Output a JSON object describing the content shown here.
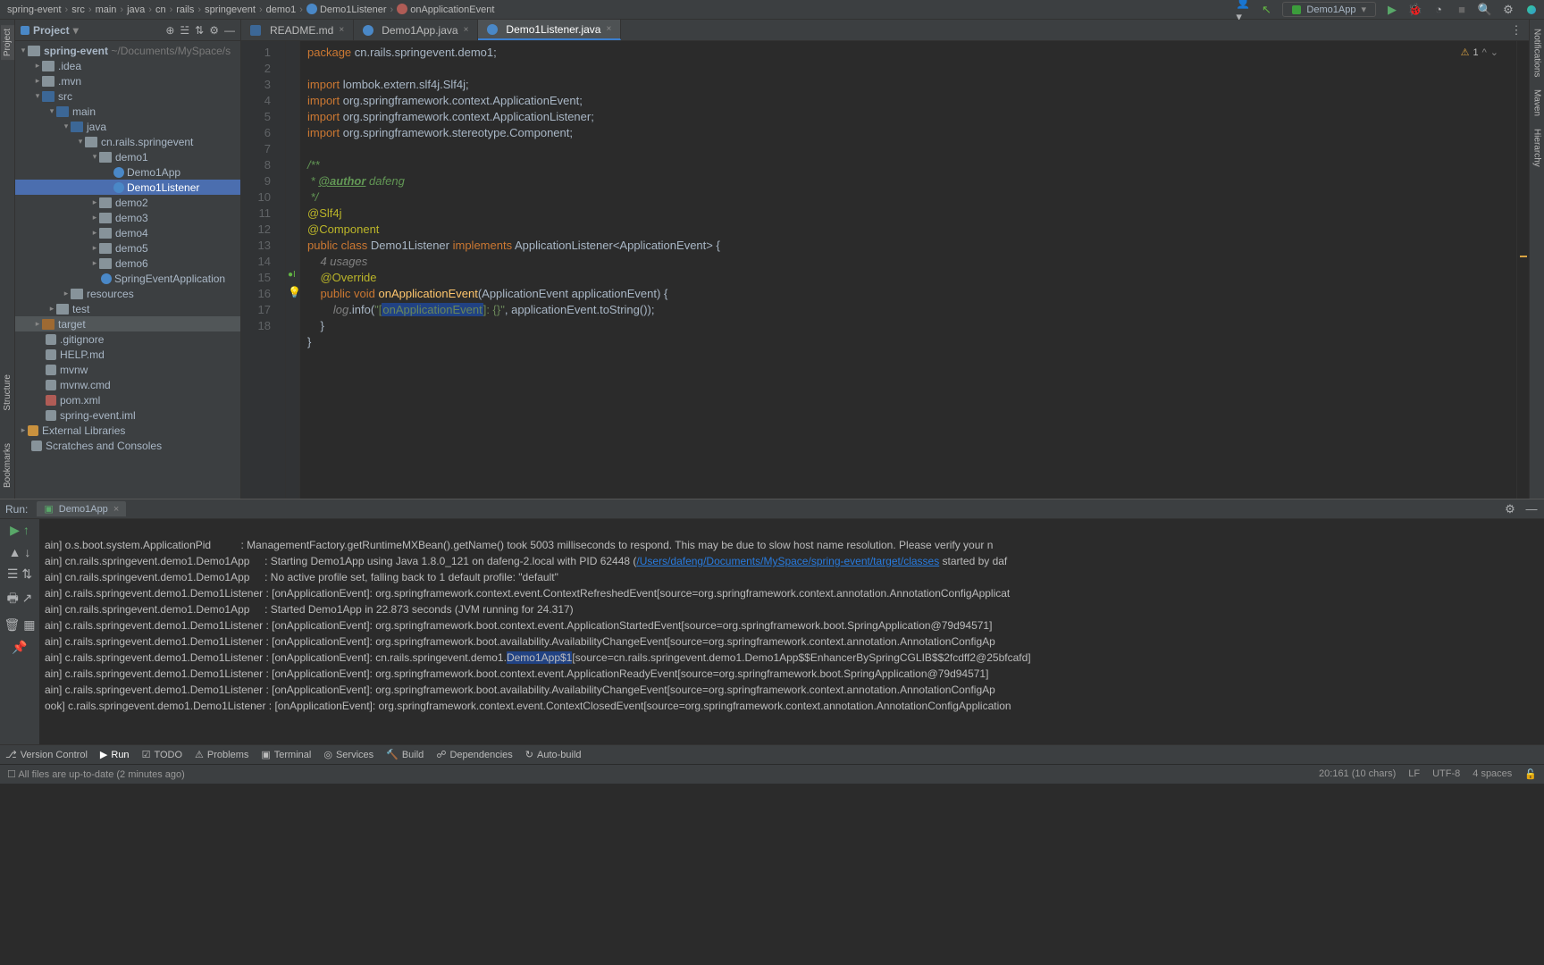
{
  "navbar": {
    "crumbs": [
      "spring-event",
      "src",
      "main",
      "java",
      "cn",
      "rails",
      "springevent",
      "demo1",
      "Demo1Listener",
      "onApplicationEvent"
    ],
    "runConfig": "Demo1App"
  },
  "leftStrip": {
    "project": "Project",
    "structure": "Structure",
    "bookmarks": "Bookmarks"
  },
  "rightStrip": {
    "notifications": "Notifications",
    "maven": "Maven",
    "hierarchy": "Hierarchy"
  },
  "sidebar": {
    "title": "Project",
    "root": {
      "name": "spring-event",
      "path": "~/Documents/MySpace/s"
    },
    "nodes": {
      "idea": ".idea",
      "mvn": ".mvn",
      "src": "src",
      "main": "main",
      "java": "java",
      "pkg": "cn.rails.springevent",
      "demo1": "demo1",
      "demo1app": "Demo1App",
      "demo1listener": "Demo1Listener",
      "demo2": "demo2",
      "demo3": "demo3",
      "demo4": "demo4",
      "demo5": "demo5",
      "demo6": "demo6",
      "springEventApp": "SpringEventApplication",
      "resources": "resources",
      "test": "test",
      "target": "target",
      "gitignore": ".gitignore",
      "help": "HELP.md",
      "mvnw": "mvnw",
      "mvnwcmd": "mvnw.cmd",
      "pom": "pom.xml",
      "iml": "spring-event.iml",
      "ext": "External Libraries",
      "scratch": "Scratches and Consoles"
    }
  },
  "tabs": {
    "t1": "README.md",
    "t2": "Demo1App.java",
    "t3": "Demo1Listener.java"
  },
  "editor": {
    "warnCount": "1",
    "usages": "4 usages",
    "pkg": "cn.rails.springevent.demo1",
    "imports": {
      "i1a": "lombok.extern.slf4j.",
      "i1b": "Slf4j",
      "i2": "org.springframework.context.ApplicationEvent",
      "i3": "org.springframework.context.ApplicationListener",
      "i4a": "org.springframework.stereotype.",
      "i4b": "Component"
    },
    "author_tag": "@author",
    "author": "dafeng",
    "ann1": "@Slf4j",
    "ann2": "@Component",
    "classname": "Demo1Listener",
    "impl": "ApplicationListener<ApplicationEvent>",
    "override": "@Override",
    "method": "onApplicationEvent",
    "param": "(ApplicationEvent applicationEvent)",
    "logvar": "log",
    "logcall": ".info(",
    "str1": "\"[",
    "selstr": "onApplicationEvent",
    "str2": "]: {}\"",
    "rest": ", applicationEvent.toString());"
  },
  "run": {
    "label": "Run:",
    "tab": "Demo1App",
    "lines": {
      "l1": "ain] o.s.boot.system.ApplicationPid          : ManagementFactory.getRuntimeMXBean().getName() took 5003 milliseconds to respond. This may be due to slow host name resolution. Please verify your n",
      "l2a": "ain] cn.rails.springevent.demo1.Demo1App     : Starting Demo1App using Java 1.8.0_121 on dafeng-2.local with PID 62448 (",
      "l2link": "/Users/dafeng/Documents/MySpace/spring-event/target/classes",
      "l2b": " started by daf",
      "l3": "ain] cn.rails.springevent.demo1.Demo1App     : No active profile set, falling back to 1 default profile: \"default\"",
      "l4": "ain] c.rails.springevent.demo1.Demo1Listener : [onApplicationEvent]: org.springframework.context.event.ContextRefreshedEvent[source=org.springframework.context.annotation.AnnotationConfigApplicat",
      "l5": "ain] cn.rails.springevent.demo1.Demo1App     : Started Demo1App in 22.873 seconds (JVM running for 24.317)",
      "l6": "ain] c.rails.springevent.demo1.Demo1Listener : [onApplicationEvent]: org.springframework.boot.context.event.ApplicationStartedEvent[source=org.springframework.boot.SpringApplication@79d94571]",
      "l7": "ain] c.rails.springevent.demo1.Demo1Listener : [onApplicationEvent]: org.springframework.boot.availability.AvailabilityChangeEvent[source=org.springframework.context.annotation.AnnotationConfigAp",
      "l8a": "ain] c.rails.springevent.demo1.Demo1Listener : [onApplicationEvent]: cn.rails.springevent.demo1.",
      "l8sel": "Demo1App$1",
      "l8b": "[source=cn.rails.springevent.demo1.Demo1App$$EnhancerBySpringCGLIB$$2fcdff2@25bfcafd]",
      "l9": "ain] c.rails.springevent.demo1.Demo1Listener : [onApplicationEvent]: org.springframework.boot.context.event.ApplicationReadyEvent[source=org.springframework.boot.SpringApplication@79d94571]",
      "l10": "ain] c.rails.springevent.demo1.Demo1Listener : [onApplicationEvent]: org.springframework.boot.availability.AvailabilityChangeEvent[source=org.springframework.context.annotation.AnnotationConfigAp",
      "l11": "ook] c.rails.springevent.demo1.Demo1Listener : [onApplicationEvent]: org.springframework.context.event.ContextClosedEvent[source=org.springframework.context.annotation.AnnotationConfigApplication"
    }
  },
  "bottom": {
    "vcs": "Version Control",
    "run": "Run",
    "todo": "TODO",
    "problems": "Problems",
    "terminal": "Terminal",
    "services": "Services",
    "build": "Build",
    "deps": "Dependencies",
    "auto": "Auto-build"
  },
  "status": {
    "msg": "All files are up-to-date (2 minutes ago)",
    "pos": "20:161 (10 chars)",
    "le": "LF",
    "enc": "UTF-8",
    "indent": "4 spaces"
  }
}
